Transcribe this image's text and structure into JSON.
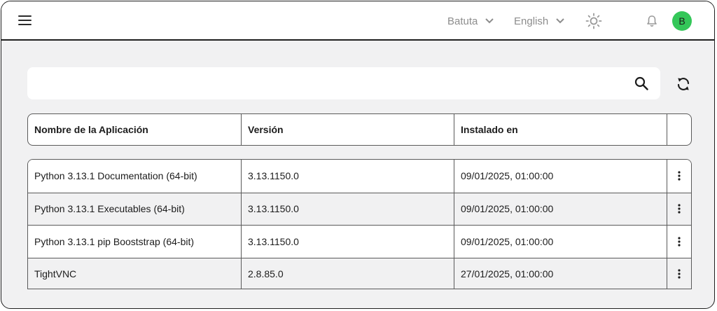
{
  "header": {
    "org_dropdown": "Batuta",
    "language_dropdown": "English",
    "avatar_initial": "B"
  },
  "search": {
    "placeholder": "",
    "value": ""
  },
  "table": {
    "columns": [
      "Nombre de la Aplicación",
      "Versión",
      "Instalado en"
    ],
    "rows": [
      {
        "name": "Python 3.13.1 Documentation (64-bit)",
        "version": "3.13.1150.0",
        "installed": "09/01/2025, 01:00:00"
      },
      {
        "name": "Python 3.13.1 Executables (64-bit)",
        "version": "3.13.1150.0",
        "installed": "09/01/2025, 01:00:00"
      },
      {
        "name": "Python 3.13.1 pip Booststrap (64-bit)",
        "version": "3.13.1150.0",
        "installed": "09/01/2025, 01:00:00"
      },
      {
        "name": "TightVNC",
        "version": "2.8.85.0",
        "installed": "27/01/2025, 01:00:00"
      }
    ]
  },
  "icons": {
    "menu": "hamburger-menu-icon",
    "theme": "sun-icon",
    "notifications": "bell-icon",
    "search": "search-icon",
    "refresh": "refresh-icon",
    "row_actions": "kebab-menu-icon"
  },
  "colors": {
    "avatar": "#34c759",
    "background": "#f1f1f2",
    "border": "#1f1f1f"
  }
}
